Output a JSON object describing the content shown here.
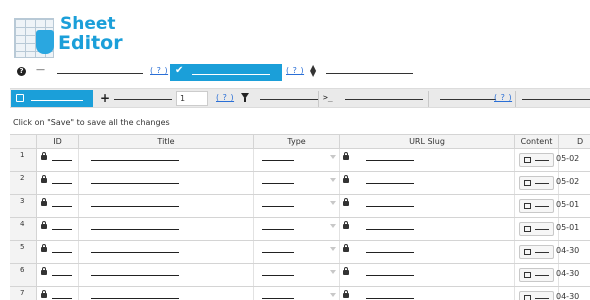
{
  "logo": {
    "line1": "Sheet",
    "line2": "Editor"
  },
  "toolbar1": {
    "help_icon": "question-circle-icon",
    "dash": "—",
    "help_link_1": "( ? )",
    "help_link_2": "( ? )",
    "check_icon": "check-icon",
    "sort_icon": "sort-icon"
  },
  "toolbar2": {
    "save_icon": "floppy-disk-icon",
    "add_icon": "plus-icon",
    "add_count_value": "1",
    "help_link": "( ? )",
    "filter_icon": "filter-icon",
    "console_icon": "console-prompt-icon",
    "console_glyph": ">_",
    "help_link_2": "( ? )"
  },
  "hint": "Click on \"Save\" to save all the changes",
  "table": {
    "headers": [
      "ID",
      "Title",
      "Type",
      "URL Slug",
      "Content",
      "D"
    ],
    "rows": [
      {
        "num": "1",
        "date": "05-02"
      },
      {
        "num": "2",
        "date": "05-02"
      },
      {
        "num": "3",
        "date": "05-01"
      },
      {
        "num": "4",
        "date": "05-01"
      },
      {
        "num": "5",
        "date": "04-30"
      },
      {
        "num": "6",
        "date": "04-30"
      },
      {
        "num": "7",
        "date": "04-30"
      }
    ]
  },
  "colors": {
    "accent": "#1b9fd9",
    "link": "#2a6fd6",
    "toolbar_bg": "#eaeaea"
  }
}
